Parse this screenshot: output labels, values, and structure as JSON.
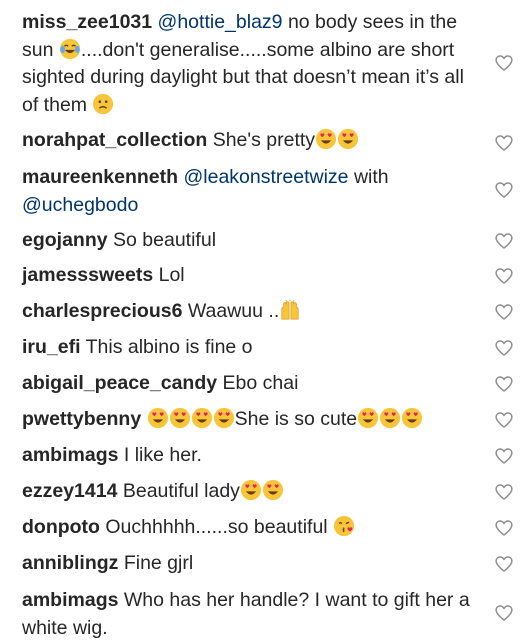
{
  "comments": [
    {
      "user": "miss_zee1031",
      "mention": "@hottie_blaz9",
      "parts": [
        "no body sees in the sun",
        "....don't generalise.....some albino are short sighted during daylight but that doesn’t mean it’s all of them"
      ],
      "emojis": [
        "tears-of-joy",
        "confused"
      ]
    },
    {
      "user": "norahpat_collection",
      "text": "She's pretty",
      "emojis": [
        "heart-eyes",
        "heart-eyes"
      ]
    },
    {
      "user": "maureenkenneth",
      "mention": "@leakonstreetwize",
      "text": "with",
      "mention2": "@uchegbodo"
    },
    {
      "user": "egojanny",
      "text": "So beautiful"
    },
    {
      "user": "jamesssweets",
      "text": "Lol"
    },
    {
      "user": "charlesprecious6",
      "text": "Waawuu ..",
      "emojis": [
        "raising-hands"
      ]
    },
    {
      "user": "iru_efi",
      "text": "This albino is fine o"
    },
    {
      "user": "abigail_peace_candy",
      "text": "Ebo chai"
    },
    {
      "user": "pwettybenny",
      "text": "She is so cute",
      "emojis": [
        "heart-eyes",
        "heart-eyes",
        "heart-eyes",
        "heart-eyes",
        "heart-eyes",
        "heart-eyes",
        "heart-eyes"
      ]
    },
    {
      "user": "ambimags",
      "text": "I like her."
    },
    {
      "user": "ezzey1414",
      "text": "Beautiful lady",
      "emojis": [
        "heart-eyes",
        "heart-eyes"
      ]
    },
    {
      "user": "donpoto",
      "text": "Ouchhhhh......so beautiful",
      "emojis": [
        "face-blowing-kiss"
      ]
    },
    {
      "user": "anniblingz",
      "text": "Fine gjrl"
    },
    {
      "user": "ambimags",
      "text": "Who has her handle? I want to gift her a white wig."
    }
  ],
  "icons": {
    "like": "heart-outline-icon"
  },
  "colors": {
    "text": "#262626",
    "mention": "#003569",
    "heart": "#8e8e8e",
    "emoji_face": "#f7c53a"
  }
}
